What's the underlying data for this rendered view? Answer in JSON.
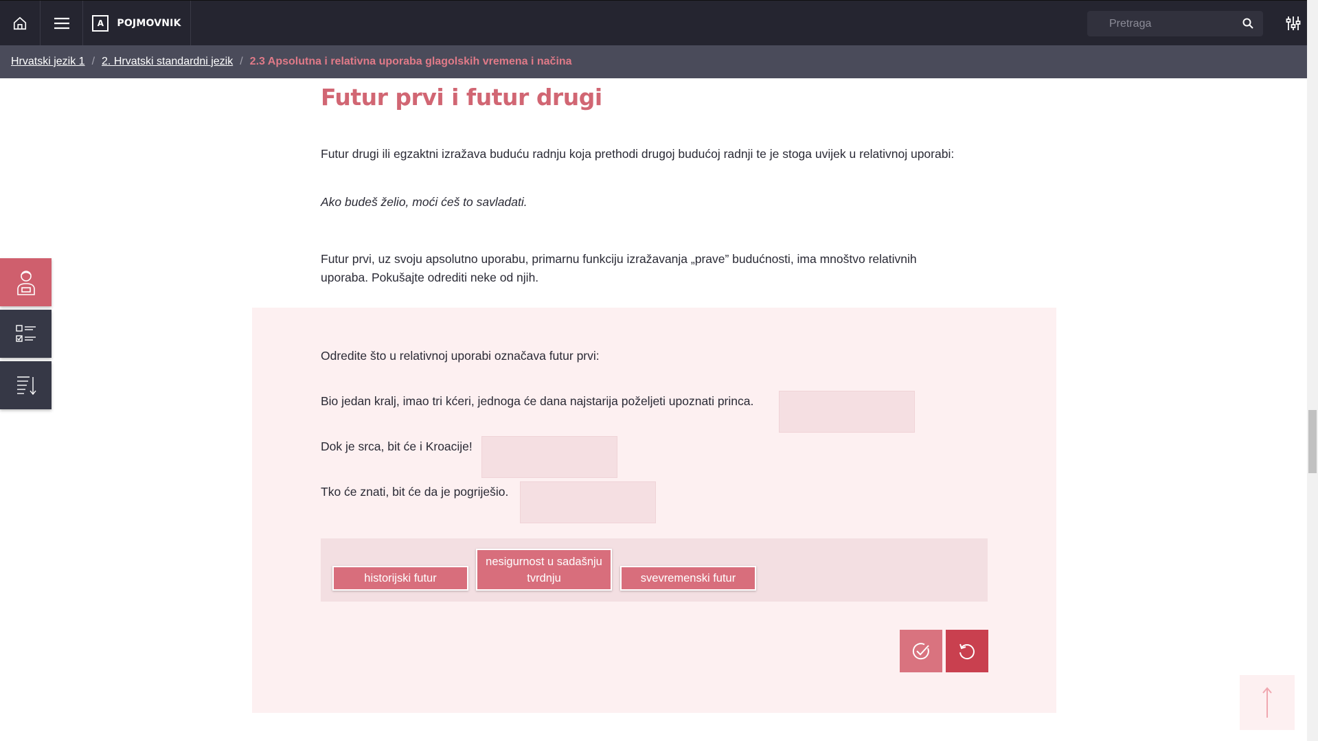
{
  "topbar": {
    "glossary_letter": "A",
    "glossary_label": "POJMOVNIK",
    "search_placeholder": "Pretraga"
  },
  "breadcrumb": {
    "items": [
      "Hrvatski jezik 1",
      "2. Hrvatski standardni jezik"
    ],
    "separator": "/",
    "current": "2.3 Apsolutna i relativna uporaba glagolskih vremena i načina"
  },
  "content": {
    "title": "Futur prvi i futur drugi",
    "paragraph1": "Futur drugi ili egzaktni izražava buduću radnju koja prethodi drugoj budućoj radnji te je stoga uvijek u relativnoj uporabi:",
    "example": "Ako budeš želio, moći ćeš to savladati.",
    "paragraph2": "Futur prvi, uz svoju apsolutno uporabu, primarnu funkciju izražavanja „prave” budućnosti, ima mnoštvo relativnih uporaba. Pokušajte odrediti neke od njih."
  },
  "exercise": {
    "instruction": "Odredite što u relativnoj uporabi označava futur prvi:",
    "sentences": [
      "Bio jedan kralj, imao tri kćeri, jednoga će dana najstarija poželjeti upoznati princa.",
      "Dok je srca, bit će i Kroacije!",
      "Tko će znati, bit će da je pogriješio."
    ],
    "options": [
      "historijski futur",
      "nesigurnost u sadašnju tvrdnju",
      "svevremenski futur"
    ]
  },
  "colors": {
    "topbar": "#252530",
    "breadcrumb": "#4a4b5a",
    "accent": "#d16673",
    "exercise_bg": "#fdf0f1"
  }
}
